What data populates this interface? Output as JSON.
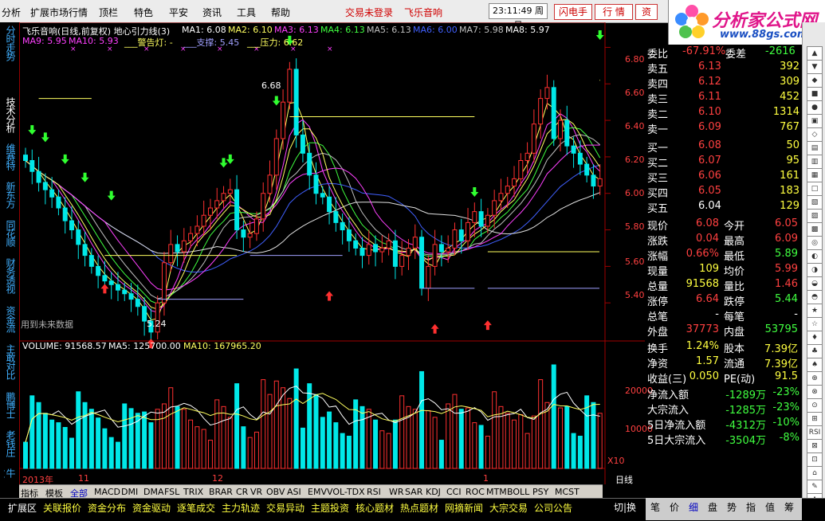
{
  "menu": {
    "items": [
      "分析",
      "扩展市场行情",
      "顶栏",
      "特色",
      "平安",
      "资讯",
      "工具",
      "帮助"
    ],
    "alert1": "交易未登录",
    "alert2": "飞乐音响",
    "clock": "23:11:49 周日",
    "btn_flash": "闪电手",
    "btn_quote": "行 情",
    "btn_info": "资"
  },
  "logo": {
    "name": "分析家公式网",
    "url": "www.88gs.com"
  },
  "left_nav": [
    "分时走势",
    "技术分析",
    "维赛特",
    "新东方",
    "同花顺",
    "财务透视",
    "资金流",
    "主敢对比",
    "鹏博士",
    "老钱庄",
    "牛文论"
  ],
  "chart": {
    "title": "飞乐音响(日线,前复权) 地心引力线(3)",
    "ma_labels": [
      "MA1: 6.08",
      "MA2: 6.10",
      "MA3: 6.13",
      "MA4: 6.13",
      "MA5: 6.13",
      "MA6: 6.00",
      "MA7: 5.98",
      "MA8: 5.97"
    ],
    "ma_row2": [
      "MA9: 5.95",
      "MA10: 5.93",
      "___警告灯: -",
      "___支撑: 5.45",
      "___压力: 6.62"
    ],
    "note": "用到未来数据",
    "peak_label": "6.68",
    "low_label": "5.24",
    "volume_info": [
      "VOLUME: 91568.57",
      "MA5: 125700.00",
      "MA10: 167965.20"
    ],
    "price_axis": [
      "6.80",
      "6.60",
      "6.40",
      "6.20",
      "6.00",
      "5.80",
      "5.60",
      "5.40"
    ],
    "volume_axis": [
      "20000",
      "10000"
    ],
    "x10": "X10",
    "period": "日线",
    "dates": [
      "2013年",
      "11",
      "12",
      "1"
    ]
  },
  "chart_data": {
    "type": "candlestick",
    "title": "飞乐音响(日线,前复权)",
    "ylim": [
      5.2,
      6.85
    ],
    "close": [
      6.18,
      6.12,
      6.06,
      6.02,
      5.98,
      5.92,
      5.85,
      5.8,
      5.72,
      5.66,
      5.6,
      5.55,
      5.52,
      5.5,
      5.47,
      5.45,
      5.42,
      5.38,
      5.3,
      5.24,
      5.4,
      5.62,
      5.72,
      5.68,
      5.74,
      5.78,
      5.82,
      5.88,
      5.92,
      5.96,
      6.0,
      6.02,
      5.8,
      5.76,
      5.78,
      5.86,
      6.0,
      6.1,
      6.3,
      6.5,
      6.68,
      6.32,
      6.22,
      6.1,
      6.0,
      5.98,
      5.9,
      5.84,
      5.8,
      5.74,
      5.7,
      5.66,
      5.72,
      5.68,
      5.7,
      5.74,
      5.6,
      5.66,
      5.7,
      5.76,
      5.48,
      5.6,
      5.72,
      5.68,
      5.7,
      5.8,
      5.74,
      5.84,
      5.9,
      5.82,
      5.88,
      5.96,
      6.0,
      6.04,
      6.08,
      6.18,
      6.22,
      6.38,
      6.52,
      6.58,
      6.3,
      6.4,
      6.26,
      6.22,
      6.16,
      6.1,
      6.04,
      6.08
    ]
  },
  "right_panel": {
    "wei": {
      "label1": "委比",
      "val1": "-67.91%",
      "label2": "委差",
      "val2": "-2616"
    },
    "sell": [
      {
        "label": "卖五",
        "price": "6.13",
        "vol": "392"
      },
      {
        "label": "卖四",
        "price": "6.12",
        "vol": "309"
      },
      {
        "label": "卖三",
        "price": "6.11",
        "vol": "452"
      },
      {
        "label": "卖二",
        "price": "6.10",
        "vol": "1314"
      },
      {
        "label": "卖一",
        "price": "6.09",
        "vol": "767"
      }
    ],
    "buy": [
      {
        "label": "买一",
        "price": "6.08",
        "vol": "50"
      },
      {
        "label": "买二",
        "price": "6.07",
        "vol": "95"
      },
      {
        "label": "买三",
        "price": "6.06",
        "vol": "161"
      },
      {
        "label": "买四",
        "price": "6.05",
        "vol": "183"
      },
      {
        "label": "买五",
        "price": "6.04",
        "vol": "129"
      }
    ],
    "stats": [
      {
        "l1": "现价",
        "v1": "6.08",
        "l2": "今开",
        "v2": "6.05"
      },
      {
        "l1": "涨跌",
        "v1": "0.04",
        "l2": "最高",
        "v2": "6.09"
      },
      {
        "l1": "涨幅",
        "v1": "0.66%",
        "l2": "最低",
        "v2": "5.89"
      },
      {
        "l1": "现量",
        "v1": "109",
        "l2": "均价",
        "v2": "5.99"
      },
      {
        "l1": "总量",
        "v1": "91568",
        "l2": "量比",
        "v2": "1.46"
      },
      {
        "l1": "涨停",
        "v1": "6.64",
        "l2": "跌停",
        "v2": "5.44"
      },
      {
        "l1": "总笔",
        "v1": "-",
        "l2": "每笔",
        "v2": "-"
      },
      {
        "l1": "外盘",
        "v1": "37773",
        "l2": "内盘",
        "v2": "53795"
      }
    ],
    "fin": [
      {
        "l1": "换手",
        "v1": "1.24%",
        "l2": "股本",
        "v2": "7.39亿"
      },
      {
        "l1": "净资",
        "v1": "1.57",
        "l2": "流通",
        "v2": "7.39亿"
      },
      {
        "l1": "收益(三)",
        "v1": "0.050",
        "l2": "PE(动)",
        "v2": "91.5"
      }
    ],
    "flows": [
      {
        "label": "净流入额",
        "val": "-1289万",
        "pct": "-23%"
      },
      {
        "label": "大宗流入",
        "val": "-1285万",
        "pct": "-23%"
      },
      {
        "label": "5日净流入额",
        "val": "-4312万",
        "pct": "-10%"
      },
      {
        "label": "5日大宗流入",
        "val": "-3504万",
        "pct": "-8%"
      }
    ]
  },
  "bottom_tabs": [
    "指标",
    "模板",
    "全部",
    "MACD",
    "DMI",
    "DMA",
    "FSL",
    "TRIX",
    "BRAR",
    "CR",
    "VR",
    "OBV",
    "ASI",
    "EMV",
    "VOL-TDX",
    "RSI",
    "WR",
    "SAR",
    "KDJ",
    "CCI",
    "ROC",
    "MTM",
    "BOLL",
    "PSY",
    "MCST"
  ],
  "bottom_bar": [
    "扩展区",
    "关联报价",
    "资金分布",
    "资金驱动",
    "逐笔成交",
    "主力轨迹",
    "交易异动",
    "主题投资",
    "核心题材",
    "热点题材",
    "网摘新闻",
    "大宗交易",
    "公司公告"
  ],
  "right_bottom_tabs": [
    "切|换",
    "笔",
    "价",
    "细",
    "盘",
    "势",
    "指",
    "值",
    "筹"
  ],
  "colors": {
    "up": "#ff3030",
    "down": "#00e8e8",
    "ma_yellow": "#ffff60",
    "ma_magenta": "#ff40ff",
    "ma_blue": "#4060ff",
    "ma_green": "#40ff40",
    "axis": "#a00000"
  }
}
